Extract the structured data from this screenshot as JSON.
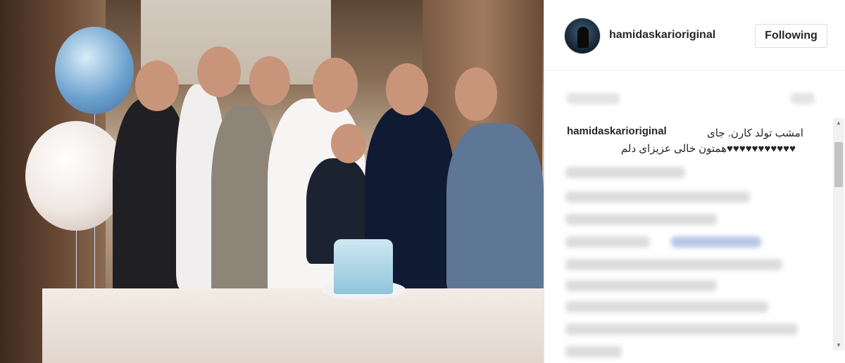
{
  "post": {
    "photo_alt": "Group photo at a birthday party",
    "header": {
      "username": "hamidaskarioriginal",
      "follow_label": "Following",
      "avatar_icon": "profile-avatar"
    },
    "caption": {
      "username": "hamidaskarioriginal",
      "line1": "امشب تولد کارن. جای",
      "line2": "♥♥♥♥♥♥♥♥♥♥♥همتون خالی عزیزای دلم"
    }
  },
  "colors": {
    "text": "#262626",
    "border": "#dbdbdb",
    "blur": "#dcdcdc"
  }
}
